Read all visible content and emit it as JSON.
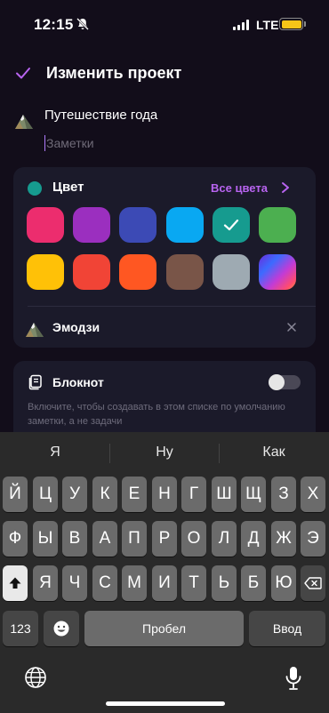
{
  "status_bar": {
    "time": "12:15",
    "network": "LTE"
  },
  "header": {
    "title": "Изменить проект"
  },
  "project": {
    "name": "Путешествие года",
    "notes_placeholder": "Заметки"
  },
  "color_section": {
    "label": "Цвет",
    "all_colors_label": "Все цвета",
    "selected_color": "#169b8f",
    "swatches": [
      "#ec2d6e",
      "#9b2fbf",
      "#3c4ab5",
      "#09a8f2",
      "#169b8f",
      "#4caf50",
      "#ffc107",
      "#f14436",
      "#ff5722",
      "#795548",
      "#9eaab2",
      "gradient"
    ]
  },
  "emoji_section": {
    "label": "Эмодзи"
  },
  "notebook_section": {
    "label": "Блокнот",
    "description": "Включите, чтобы создавать в этом списке по умолчанию заметки, а не задачи",
    "enabled": false
  },
  "keyboard": {
    "suggestions": [
      "Я",
      "Ну",
      "Как"
    ],
    "row1": [
      "Й",
      "Ц",
      "У",
      "К",
      "Е",
      "Н",
      "Г",
      "Ш",
      "Щ",
      "З",
      "Х"
    ],
    "row2": [
      "Ф",
      "Ы",
      "В",
      "А",
      "П",
      "Р",
      "О",
      "Л",
      "Д",
      "Ж",
      "Э"
    ],
    "row3": [
      "Я",
      "Ч",
      "С",
      "М",
      "И",
      "Т",
      "Ь",
      "Б",
      "Ю"
    ],
    "numbers_key": "123",
    "space_key": "Пробел",
    "return_key": "Ввод"
  }
}
